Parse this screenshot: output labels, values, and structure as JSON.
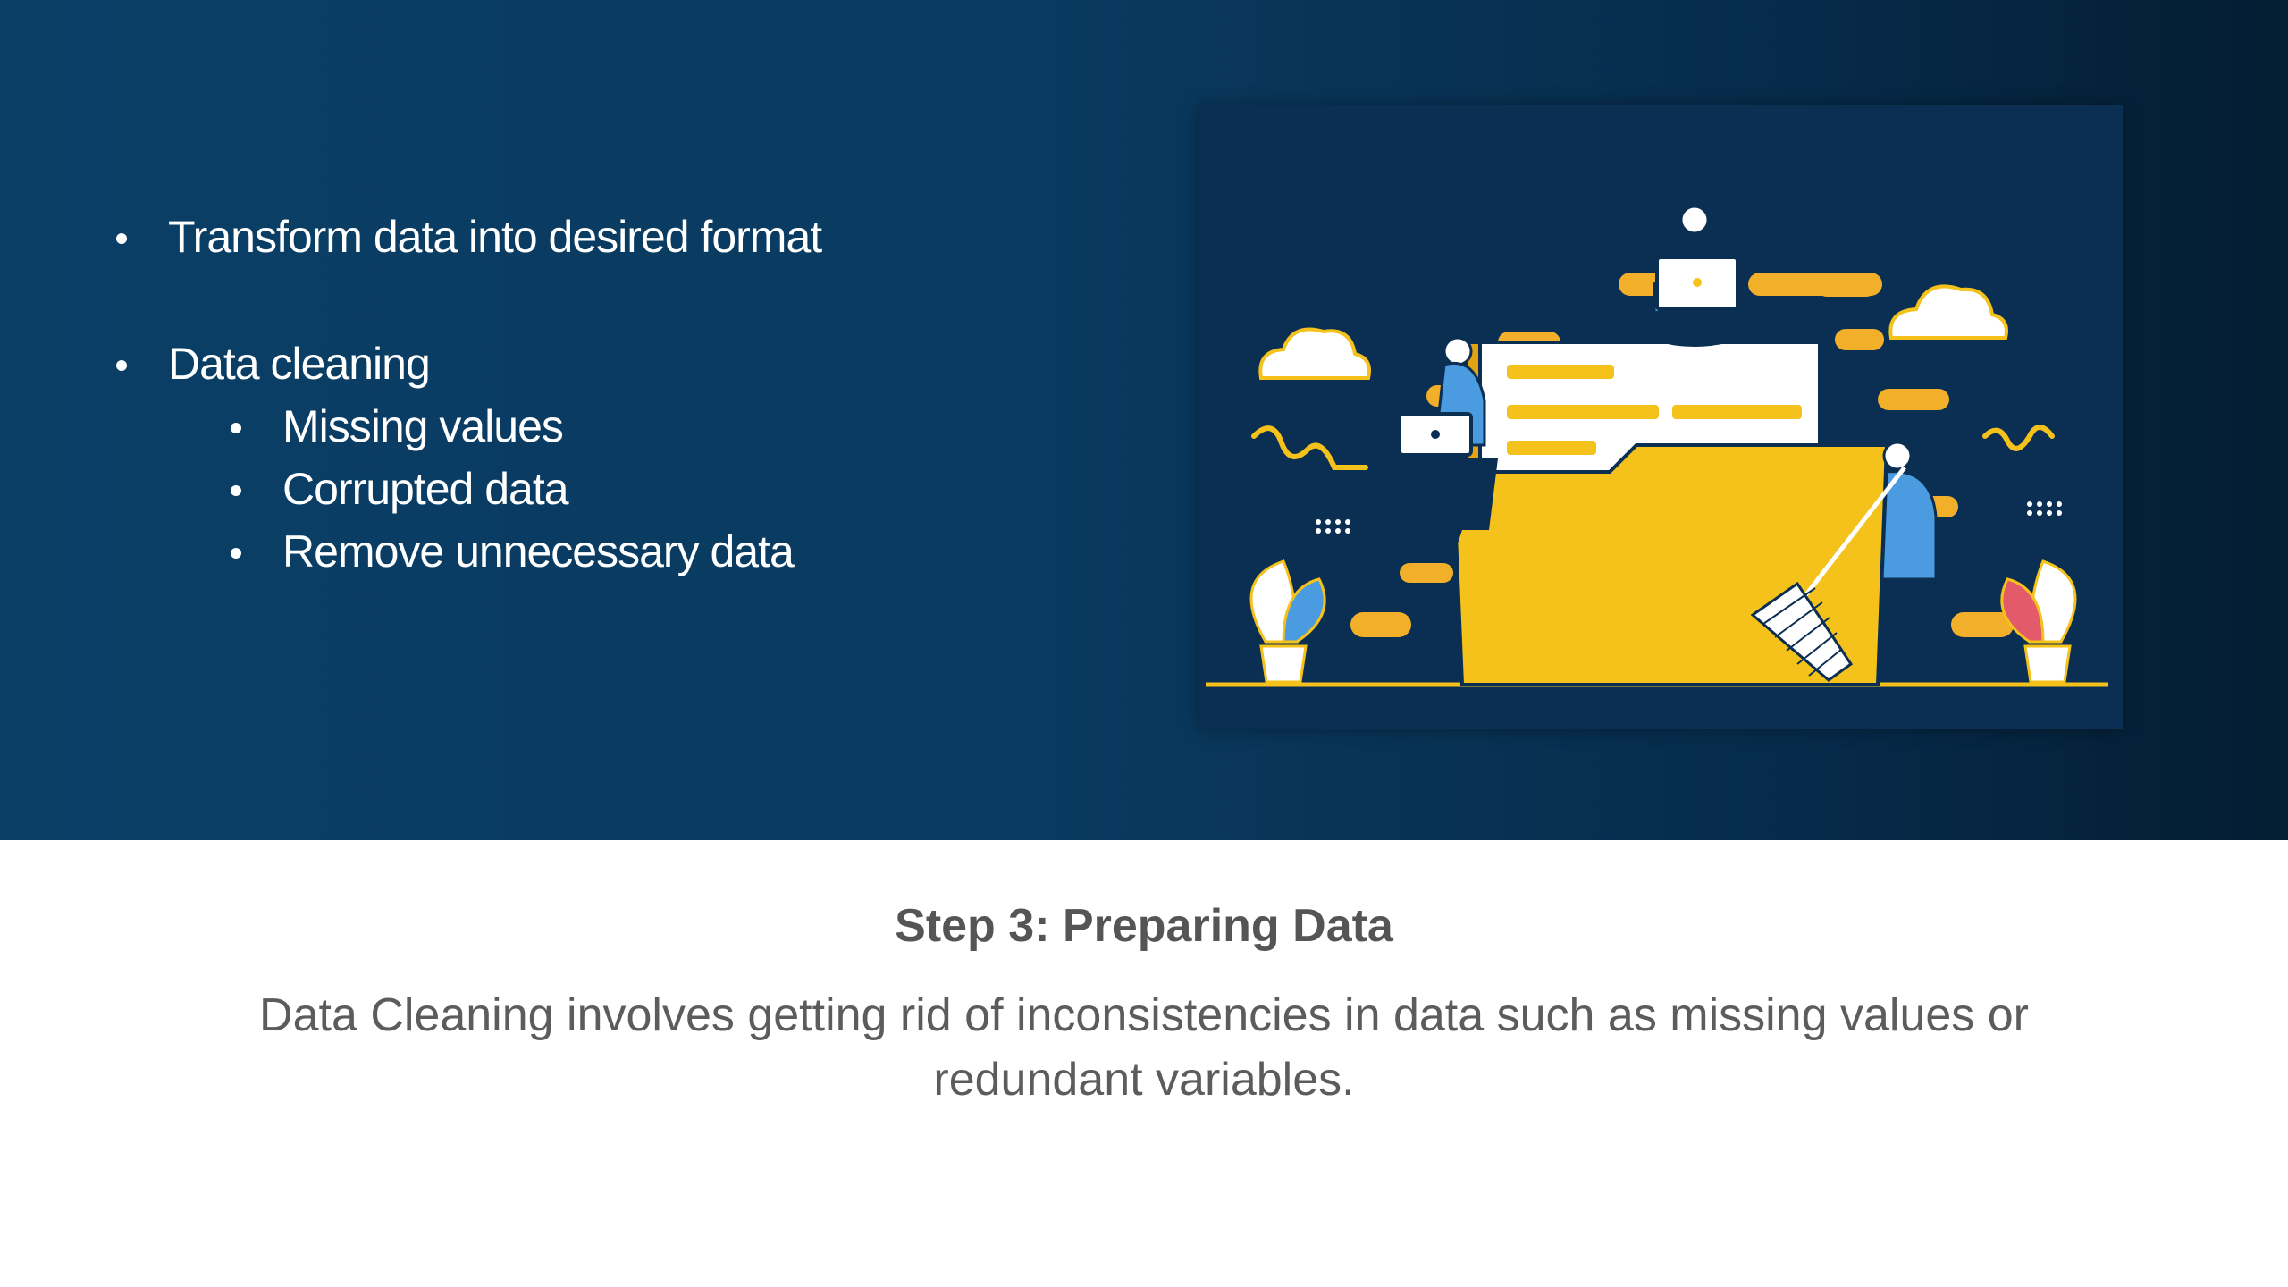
{
  "slide": {
    "bullets": {
      "transform": "Transform data into desired format",
      "cleaning": "Data cleaning",
      "sub": [
        "Missing values",
        "Corrupted data",
        "Remove unnecessary data"
      ]
    },
    "colors": {
      "background": "#0b3f66",
      "folder": "#f5c21b",
      "accent": "#f2b02a",
      "person": "#4b9be0"
    },
    "illustration": {
      "icon": "data-cleaning-illustration"
    }
  },
  "caption": {
    "title": "Step 3: Preparing Data",
    "text": "Data Cleaning involves getting rid of inconsistencies in data such as missing values or redundant variables."
  }
}
